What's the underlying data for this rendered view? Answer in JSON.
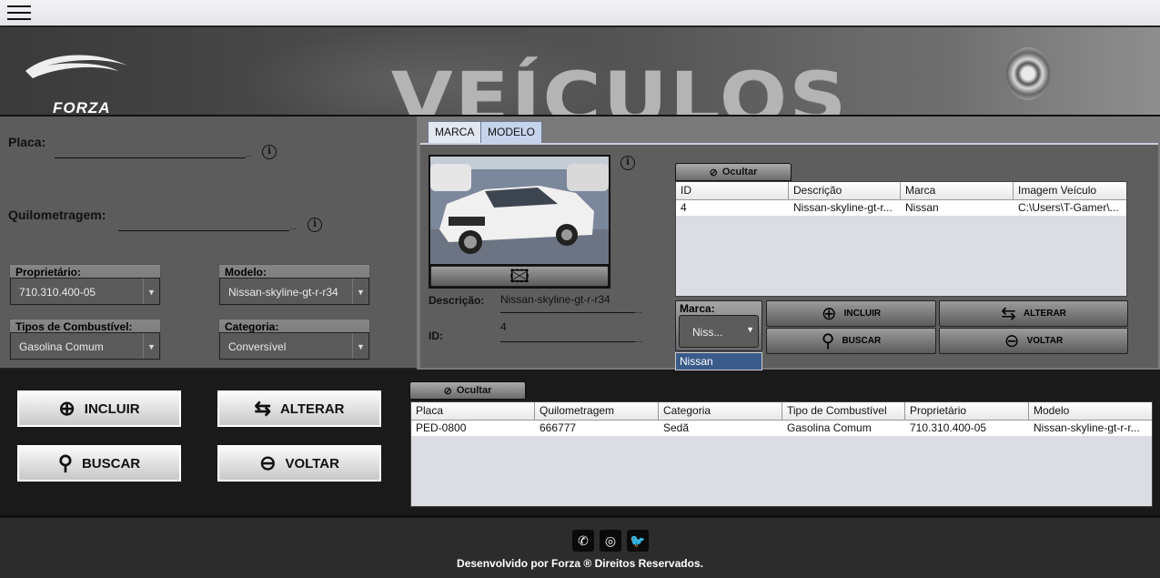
{
  "header": {
    "menu_icon": "hamburger-icon",
    "title": "VEÍCULOS",
    "logo_text": "FORZA"
  },
  "form": {
    "placa_label": "Placa:",
    "placa_value": "",
    "quilometragem_label": "Quilometragem:",
    "quilometragem_value": "",
    "proprietario": {
      "label": "Proprietário:",
      "value": "710.310.400-05"
    },
    "modelo": {
      "label": "Modelo:",
      "value": "Nissan-skyline-gt-r-r34"
    },
    "combustivel": {
      "label": "Tipos de Combustível:",
      "value": "Gasolina Comum"
    },
    "categoria": {
      "label": "Categoria:",
      "value": "Conversível"
    }
  },
  "actions": {
    "incluir": "INCLUIR",
    "alterar": "ALTERAR",
    "buscar": "BUSCAR",
    "voltar": "VOLTAR"
  },
  "tabs": [
    {
      "label": "MARCA"
    },
    {
      "label": "MODELO"
    }
  ],
  "modelo_panel": {
    "descricao_label": "Descrição:",
    "descricao_value": "Nissan-skyline-gt-r-r34",
    "id_label": "ID:",
    "id_value": "4",
    "ocultar_label": "Ocultar",
    "marca_combo": {
      "label": "Marca:",
      "value": "Niss...",
      "options": [
        "Nissan"
      ]
    },
    "buttons": {
      "incluir": "INCLUIR",
      "alterar": "ALTERAR",
      "buscar": "BUSCAR",
      "voltar": "VOLTAR"
    },
    "table": {
      "headers": [
        "ID",
        "Descrição",
        "Marca",
        "Imagem Veículo"
      ],
      "rows": [
        [
          "4",
          "Nissan-skyline-gt-r...",
          "Nissan",
          "C:\\Users\\T-Gamer\\..."
        ]
      ]
    }
  },
  "vehicles": {
    "ocultar_label": "Ocultar",
    "headers": [
      "Placa",
      "Quilometragem",
      "Categoria",
      "Tipo de Combustível",
      "Proprietário",
      "Modelo"
    ],
    "rows": [
      [
        "PED-0800",
        "666777",
        "Sedã",
        "Gasolina Comum",
        "710.310.400-05",
        "Nissan-skyline-gt-r-r..."
      ]
    ]
  },
  "footer": {
    "icons": [
      "whatsapp-icon",
      "instagram-icon",
      "twitter-icon"
    ],
    "text": "Desenvolvido por Forza ® Direitos Reservados."
  }
}
